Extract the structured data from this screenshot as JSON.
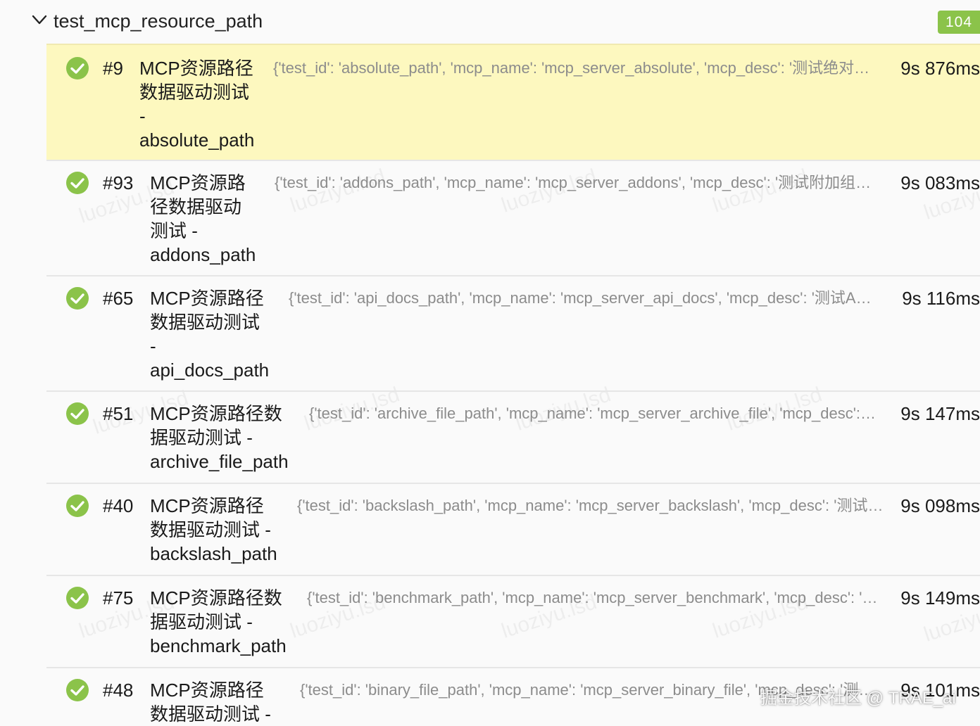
{
  "group": {
    "title": "test_mcp_resource_path",
    "count": "104"
  },
  "rows": [
    {
      "num": "#9",
      "title": "MCP资源路径\n数据驱动测试\n-\nabsolute_path",
      "params": "{'test_id': 'absolute_path', 'mcp_name': 'mcp_server_absolute', 'mcp_desc': '测试绝对路径'}",
      "duration": "9s 876ms",
      "status": "passed"
    },
    {
      "num": "#93",
      "title": "MCP资源路\n径数据驱动\n测试 -\naddons_path",
      "params": "{'test_id': 'addons_path', 'mcp_name': 'mcp_server_addons', 'mcp_desc': '测试附加组件路径'}",
      "duration": "9s 083ms",
      "status": "passed"
    },
    {
      "num": "#65",
      "title": "MCP资源路径\n数据驱动测试\n-\napi_docs_path",
      "params": "{'test_id': 'api_docs_path', 'mcp_name': 'mcp_server_api_docs', 'mcp_desc': '测试API文档路径'}",
      "duration": "9s 116ms",
      "status": "passed"
    },
    {
      "num": "#51",
      "title": "MCP资源路径数\n据驱动测试 -\narchive_file_path",
      "params": "{'test_id': 'archive_file_path', 'mcp_name': 'mcp_server_archive_file', 'mcp_desc': '测试归档文件路径'}",
      "duration": "9s 147ms",
      "status": "passed"
    },
    {
      "num": "#40",
      "title": "MCP资源路径\n数据驱动测试 -\nbackslash_path",
      "params": "{'test_id': 'backslash_path', 'mcp_name': 'mcp_server_backslash', 'mcp_desc': '测试反斜杠路径'}",
      "duration": "9s 098ms",
      "status": "passed"
    },
    {
      "num": "#75",
      "title": "MCP资源路径数\n据驱动测试 -\nbenchmark_path",
      "params": "{'test_id': 'benchmark_path', 'mcp_name': 'mcp_server_benchmark', 'mcp_desc': '测试基准路径'}",
      "duration": "9s 149ms",
      "status": "passed"
    },
    {
      "num": "#48",
      "title": "MCP资源路径\n数据驱动测试 -\nbinary_file_path",
      "params": "{'test_id': 'binary_file_path', 'mcp_name': 'mcp_server_binary_file', 'mcp_desc': '测试二进制文件路径'}",
      "duration": "9s 101ms",
      "status": "passed"
    }
  ],
  "watermark": "luoziyu.lsd",
  "corner_watermark": "掘金技术社区 @ TRAE_ai",
  "colors": {
    "passed": "#8bc34a",
    "selected_row_bg": "#fdf8bf",
    "badge_bg": "#8bc34a"
  }
}
